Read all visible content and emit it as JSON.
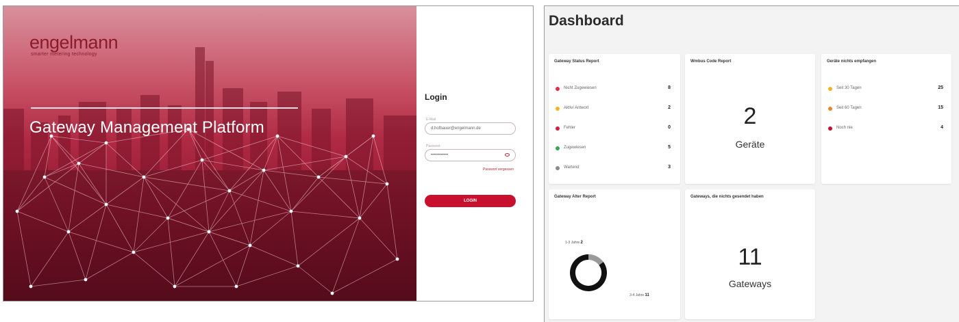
{
  "login": {
    "logo_text": "engelmann",
    "logo_tagline": "smarter metering technology",
    "hero_title": "Gateway Management Platform",
    "title": "Login",
    "email_label": "E-Mail",
    "email_value": "d.hofbauer@engelmann.de",
    "password_label": "Passwort",
    "password_value": "••••••••••••",
    "forgot_password": "Passwort vergessen",
    "login_button": "LOGIN",
    "accent_color": "#c8102e"
  },
  "dashboard": {
    "title": "Dashboard",
    "status_report": {
      "title": "Gateway Status Report",
      "rows": [
        {
          "label": "Nicht Zugewiesen",
          "count": "8",
          "color": "#e8294c"
        },
        {
          "label": "Aktiv/ Antwort",
          "count": "2",
          "color": "#f5b324"
        },
        {
          "label": "Fehler",
          "count": "0",
          "color": "#d81b3f"
        },
        {
          "label": "Zugewiesen",
          "count": "5",
          "color": "#3aa655"
        },
        {
          "label": "Wartend",
          "count": "3",
          "color": "#8a8a8a"
        }
      ]
    },
    "wmbus_report": {
      "title": "Wmbus Code Report",
      "value": "2",
      "unit": "Geräte"
    },
    "not_received": {
      "title": "Geräte nichts empfangen",
      "rows": [
        {
          "label": "Seit 30 Tagen",
          "count": "25",
          "color": "#f5b324"
        },
        {
          "label": "Seit 60 Tagen",
          "count": "15",
          "color": "#f0842a"
        },
        {
          "label": "Noch nie",
          "count": "4",
          "color": "#c8102e"
        }
      ]
    },
    "age_report": {
      "title": "Gateway Alter Report",
      "segments": [
        {
          "label": "1-3 Jahre",
          "count": "2",
          "fraction": 0.15,
          "color": "#9a9a9a"
        },
        {
          "label": "3-4 Jahre",
          "count": "11",
          "fraction": 0.85,
          "color": "#111111"
        }
      ]
    },
    "not_reported": {
      "title": "Gateways, die nichts gesendet haben",
      "value": "11",
      "unit": "Gateways"
    }
  }
}
